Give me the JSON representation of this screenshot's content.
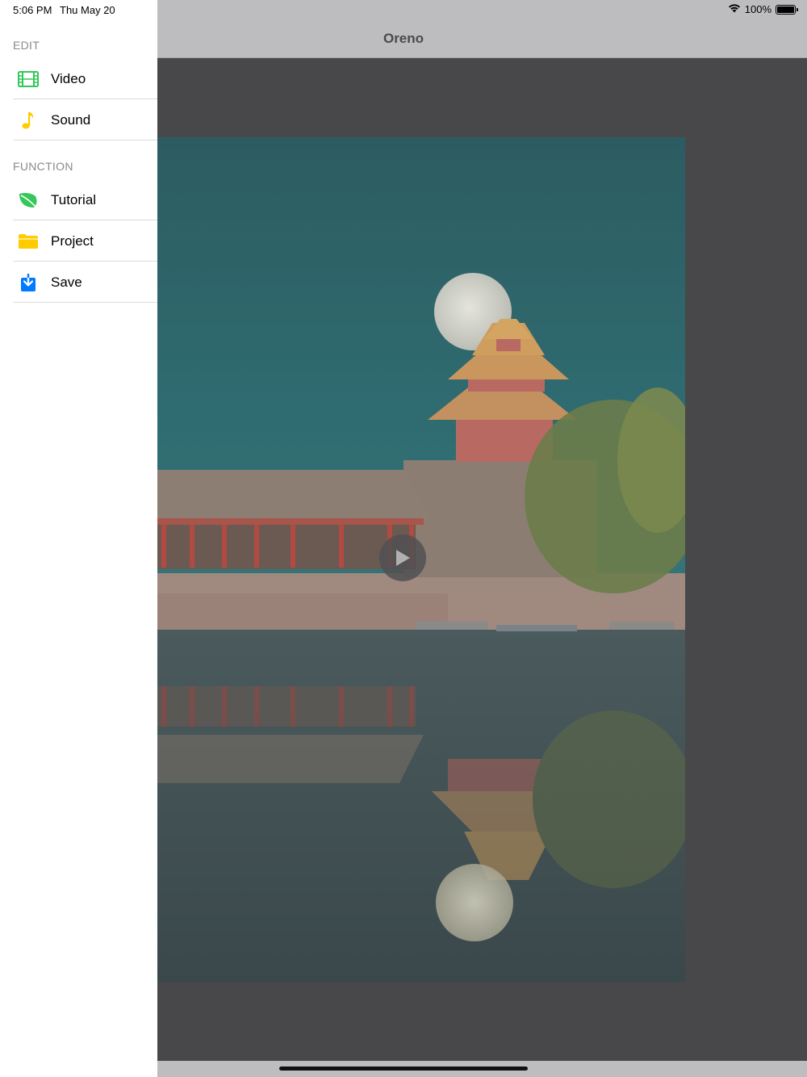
{
  "status_bar": {
    "time": "5:06 PM",
    "date": "Thu May 20",
    "battery": "100%",
    "battery_level": 1.0
  },
  "nav": {
    "title": "Oreno"
  },
  "sidebar": {
    "sections": [
      {
        "header": "EDIT",
        "items": [
          {
            "label": "Video",
            "icon": "film-icon",
            "color": "#34c759"
          },
          {
            "label": "Sound",
            "icon": "music-note-icon",
            "color": "#ffcc00"
          }
        ]
      },
      {
        "header": "FUNCTION",
        "items": [
          {
            "label": "Tutorial",
            "icon": "leaf-icon",
            "color": "#34c759"
          },
          {
            "label": "Project",
            "icon": "folder-icon",
            "color": "#ffcc00"
          },
          {
            "label": "Save",
            "icon": "download-icon",
            "color": "#007aff"
          }
        ]
      }
    ]
  },
  "preview": {
    "icon": "play-icon",
    "colors": {
      "sky": "#2f6a6e",
      "water": "#3e5055",
      "overlay": "#48484a"
    }
  }
}
